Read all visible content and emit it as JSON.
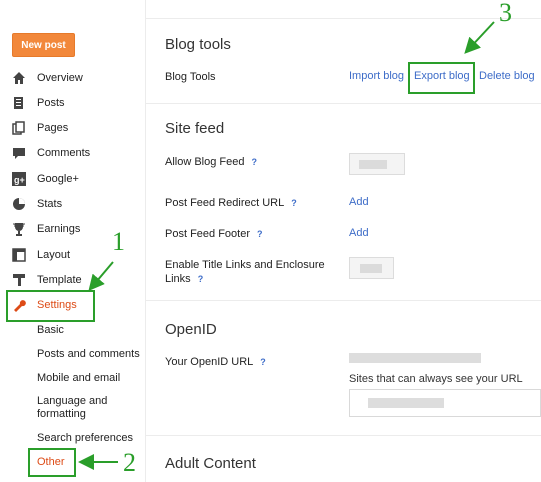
{
  "sidebar": {
    "new_post": "New post",
    "items": [
      {
        "label": "Overview",
        "icon": "home-icon"
      },
      {
        "label": "Posts",
        "icon": "posts-icon"
      },
      {
        "label": "Pages",
        "icon": "pages-icon"
      },
      {
        "label": "Comments",
        "icon": "comments-icon"
      },
      {
        "label": "Google+",
        "icon": "google-plus-icon"
      },
      {
        "label": "Stats",
        "icon": "stats-icon"
      },
      {
        "label": "Earnings",
        "icon": "trophy-icon"
      },
      {
        "label": "Layout",
        "icon": "layout-icon"
      },
      {
        "label": "Template",
        "icon": "template-icon"
      },
      {
        "label": "Settings",
        "icon": "wrench-icon"
      }
    ],
    "sub_items": [
      "Basic",
      "Posts and comments",
      "Mobile and email",
      "Language and formatting",
      "Search preferences",
      "Other"
    ]
  },
  "annotations": {
    "one": "1",
    "two": "2",
    "three": "3"
  },
  "blog_tools": {
    "title": "Blog tools",
    "row_label": "Blog Tools",
    "import": "Import blog",
    "export": "Export blog",
    "delete": "Delete blog"
  },
  "site_feed": {
    "title": "Site feed",
    "allow_feed": "Allow Blog Feed",
    "redirect_url": "Post Feed Redirect URL",
    "footer": "Post Feed Footer",
    "title_links": "Enable Title Links and Enclosure Links",
    "add": "Add",
    "help": "?"
  },
  "openid": {
    "title": "OpenID",
    "url_label": "Your OpenID URL",
    "sites_label": "Sites that can always see your URL"
  },
  "adult": {
    "title": "Adult Content"
  },
  "colors": {
    "accent": "#dd4b16",
    "new_post_bg": "#f2883b",
    "link": "#3d6cc8",
    "annotation": "#2a9e2a"
  }
}
